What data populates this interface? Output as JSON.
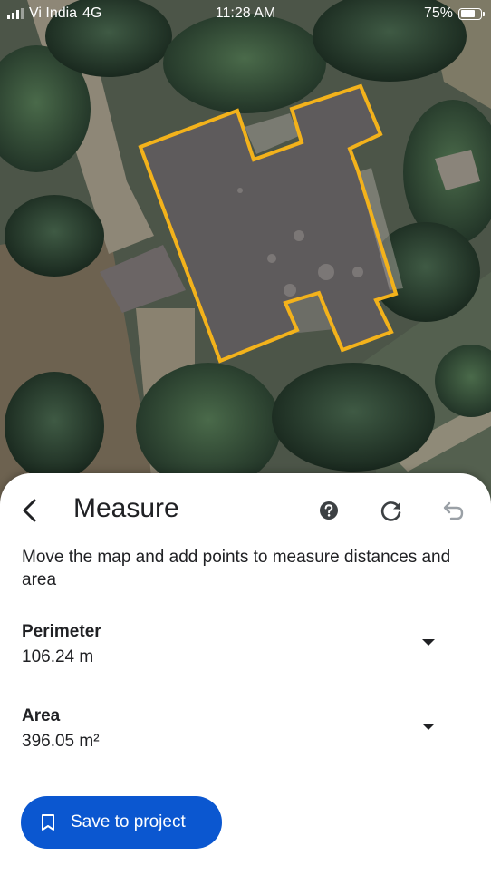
{
  "status_bar": {
    "carrier": "Vi India",
    "network": "4G",
    "time": "11:28 AM",
    "battery_percent": "75%",
    "battery_level": 0.75
  },
  "map": {
    "outline_color": "#f3b21b",
    "roof_color": "#5e5b5c"
  },
  "sheet": {
    "title": "Measure",
    "description": "Move the map and add points to measure distances and area",
    "perimeter": {
      "label": "Perimeter",
      "value": "106.24 m"
    },
    "area": {
      "label": "Area",
      "value": "396.05 m²"
    },
    "save_button_label": "Save to project",
    "accent_color": "#0b57d0",
    "icons": {
      "back": "chevron-left-icon",
      "help": "help-circle-icon",
      "reset": "refresh-icon",
      "undo": "undo-icon",
      "bookmark": "bookmark-icon",
      "expand": "caret-down-icon"
    }
  }
}
